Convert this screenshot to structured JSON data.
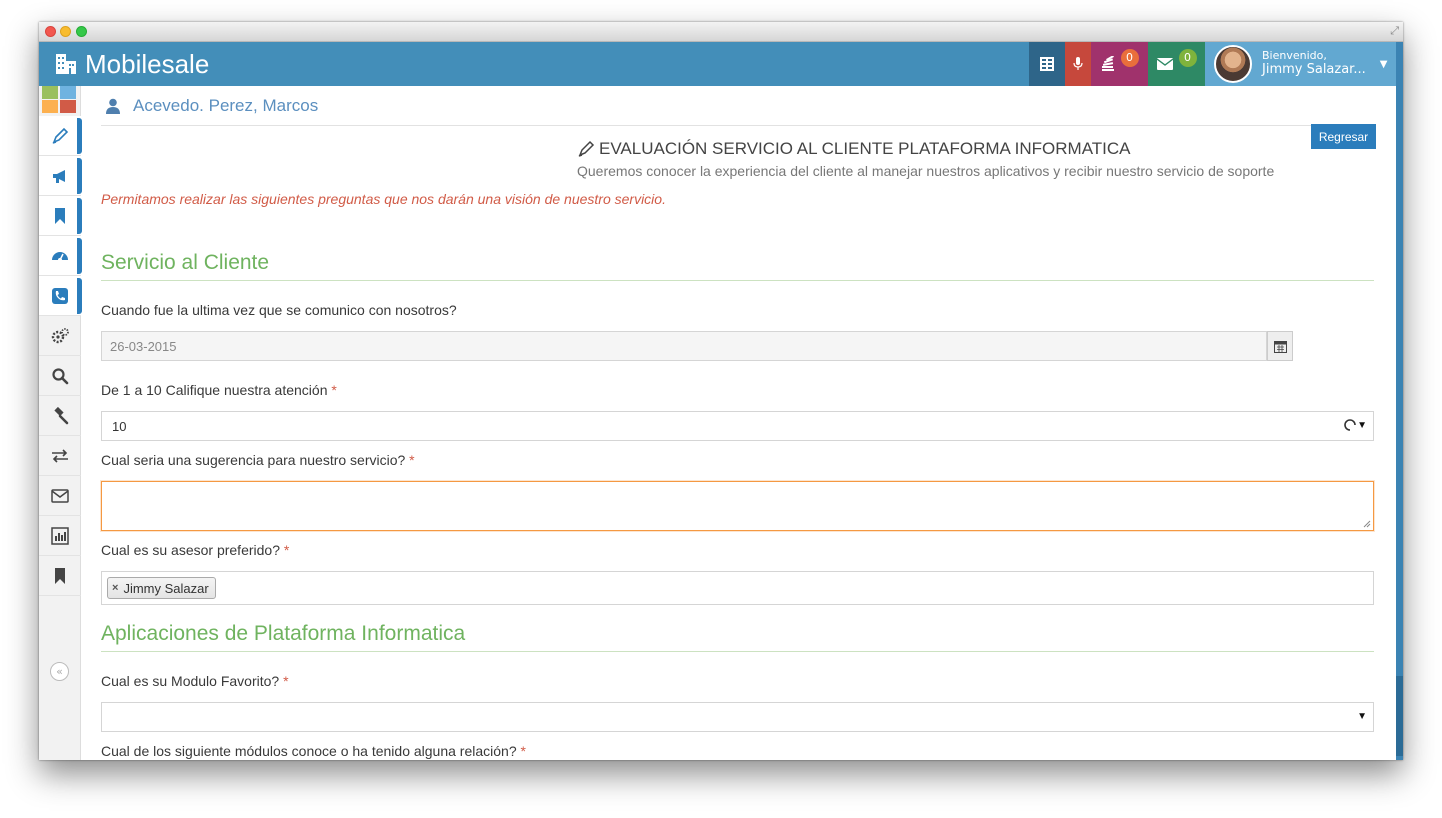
{
  "app": {
    "title": "Mobilesale"
  },
  "navbar": {
    "notifications_count": "0",
    "messages_count": "0",
    "user_greeting": "Bienvenido,",
    "user_name": "Jimmy Salazar..."
  },
  "colors": {
    "navbar": "#438eb9",
    "tile_dark": "#2e6589",
    "tile_red": "#c6483c",
    "tile_purple": "#a0326c",
    "tile_green": "#2e8965",
    "tile_user": "#62a8d1",
    "section_title": "#6fb35f",
    "required": "#d15b47",
    "focus_border": "#f59942",
    "primary_button": "#2b7dbc"
  },
  "sidebar": {
    "items": [
      {
        "icon": "pencil-icon",
        "active": true
      },
      {
        "icon": "bullhorn-icon",
        "active": true
      },
      {
        "icon": "bookmark-icon",
        "active": true
      },
      {
        "icon": "dashboard-icon",
        "active": true
      },
      {
        "icon": "phone-icon",
        "active": true
      },
      {
        "icon": "gears-icon",
        "active": false
      },
      {
        "icon": "search-icon",
        "active": false
      },
      {
        "icon": "gavel-icon",
        "active": false
      },
      {
        "icon": "exchange-icon",
        "active": false
      },
      {
        "icon": "envelope-icon",
        "active": false
      },
      {
        "icon": "bar-chart-icon",
        "active": false
      },
      {
        "icon": "bookmark-icon",
        "active": false
      }
    ],
    "collapse_icon": "double-angle-left-icon"
  },
  "page": {
    "customer_name": "Acevedo. Perez, Marcos",
    "back_button": "Regresar",
    "form_title": "EVALUACIÓN SERVICIO AL CLIENTE PLATAFORMA INFORMATICA",
    "form_subtitle": "Queremos conocer la experiencia del cliente al manejar nuestros aplicativos y recibir nuestro servicio de soporte",
    "intro": "Permitamos realizar las siguientes preguntas que nos darán una visión de nuestro servicio."
  },
  "sections": [
    {
      "title": "Servicio al Cliente",
      "questions": [
        {
          "label": "Cuando fue la ultima vez que se comunico con nosotros?",
          "required": false,
          "type": "date",
          "value": "26-03-2015"
        },
        {
          "label": "De 1 a 10 Califique nuestra atención",
          "required": true,
          "type": "select",
          "value": "10"
        },
        {
          "label": "Cual seria una sugerencia para nuestro servicio?",
          "required": true,
          "type": "textarea",
          "value": ""
        },
        {
          "label": "Cual es su asesor preferido?",
          "required": true,
          "type": "tags",
          "tags": [
            "Jimmy Salazar"
          ]
        }
      ]
    },
    {
      "title": "Aplicaciones de Plataforma Informatica",
      "questions": [
        {
          "label": "Cual es su Modulo Favorito?",
          "required": true,
          "type": "select",
          "value": ""
        },
        {
          "label": "Cual de los siguiente módulos conoce o ha tenido alguna relación?",
          "required": true,
          "type": "checkbox-group"
        }
      ]
    }
  ],
  "required_marker": "*"
}
